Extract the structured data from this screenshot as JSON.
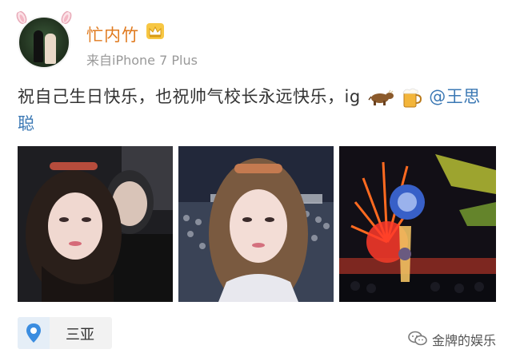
{
  "post": {
    "username": "忙内竹",
    "source": "来自iPhone 7 Plus",
    "text_part1": "祝自己生日快乐，也祝帅气校长永远快乐，ig",
    "mention": "@王思聪"
  },
  "location": {
    "name": "三亚"
  },
  "watermark": {
    "text": "金牌的娱乐"
  },
  "colors": {
    "username": "#e07b20",
    "mention": "#3b78b4",
    "secondary_text": "#999999"
  },
  "icons": [
    "bunny-ears-icon",
    "crown-badge-icon",
    "cow-emoji",
    "beer-emoji",
    "location-pin-icon",
    "wechat-logo-icon"
  ]
}
